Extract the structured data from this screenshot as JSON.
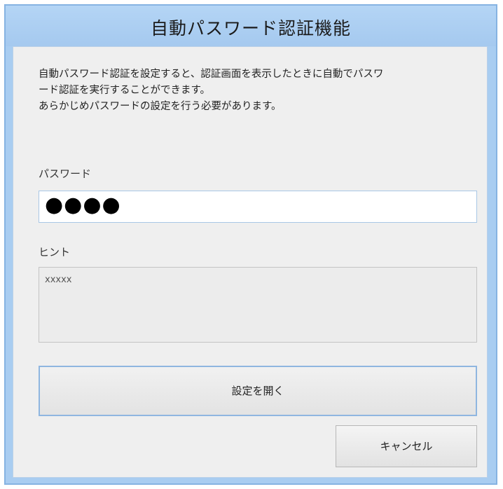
{
  "window": {
    "title": "自動パスワード認証機能"
  },
  "description": {
    "line1": "自動パスワード認証を設定すると、認証画面を表示したときに自動でパスワ",
    "line2": "ード認証を実行することができます。",
    "line3": "あらかじめパスワードの設定を行う必要があります。"
  },
  "password": {
    "label": "パスワード",
    "value": "●●●●"
  },
  "hint": {
    "label": "ヒント",
    "value": "xxxxx"
  },
  "buttons": {
    "open_settings": "設定を開く",
    "cancel": "キャンセル"
  },
  "colors": {
    "titlebar": "#a9cdf1",
    "client_background": "#efefef",
    "focus_border": "#8fb6e0"
  }
}
